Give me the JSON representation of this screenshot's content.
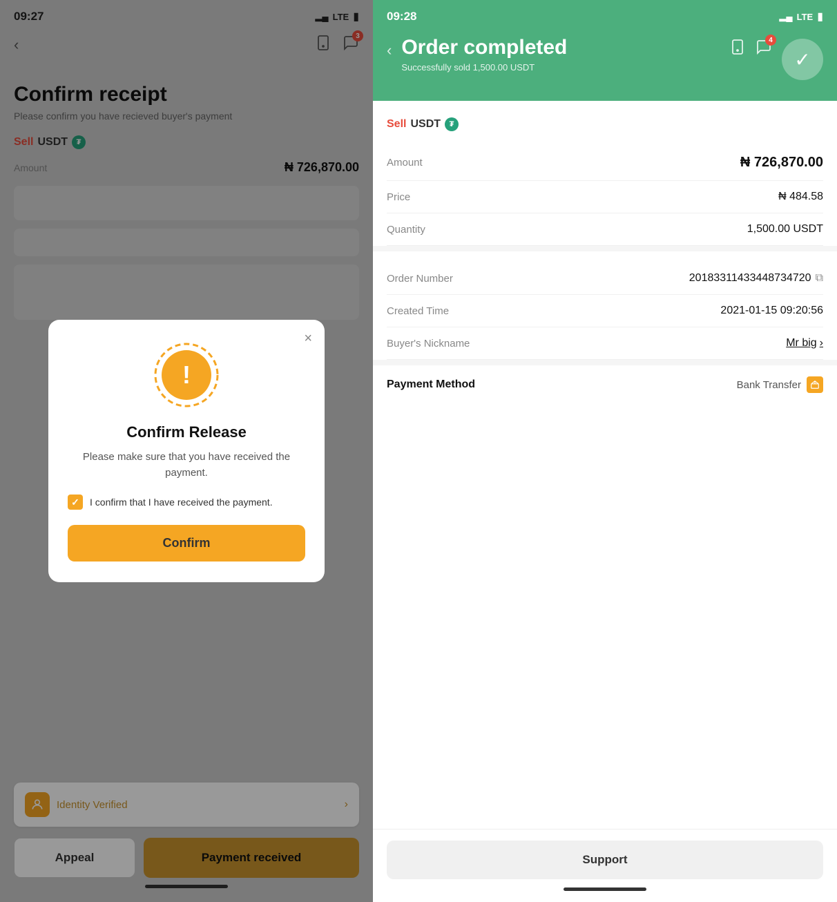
{
  "left": {
    "statusBar": {
      "time": "09:27",
      "signal": "▂▄",
      "lte": "LTE",
      "battery": "🔋"
    },
    "header": {
      "backArrow": "‹",
      "badge": "3"
    },
    "pageTitle": "Confirm receipt",
    "pageSubtitle": "Please confirm you have recieved buyer's payment",
    "sellLabel": "Sell",
    "usdtLabel": "USDT",
    "amountLabel": "Amount",
    "amountValue": "₦ 726,870.00",
    "identityLabel": "Identity Verified",
    "identityArrow": ">",
    "buttons": {
      "appeal": "Appeal",
      "paymentReceived": "Payment received"
    },
    "modal": {
      "title": "Confirm Release",
      "text": "Please make sure that you have received the payment.",
      "checkboxLabel": "I confirm that I have received the payment.",
      "confirmBtn": "Confirm",
      "closeBtn": "×"
    }
  },
  "right": {
    "statusBar": {
      "time": "09:28",
      "signal": "▂▄",
      "lte": "LTE",
      "battery": "🔋"
    },
    "header": {
      "backArrow": "‹",
      "title": "Order completed",
      "subtitle": "Successfully sold 1,500.00 USDT",
      "badge": "4"
    },
    "sellLabel": "Sell",
    "usdtLabel": "USDT",
    "rows": [
      {
        "label": "Amount",
        "value": "₦ 726,870.00",
        "large": true
      },
      {
        "label": "Price",
        "value": "₦ 484.58",
        "large": false
      },
      {
        "label": "Quantity",
        "value": "1,500.00 USDT",
        "large": false
      }
    ],
    "orderDetails": [
      {
        "label": "Order Number",
        "value": "2018331143344873 4720",
        "copy": true
      },
      {
        "label": "Created Time",
        "value": "2021-01-15 09:20:56"
      },
      {
        "label": "Buyer's Nickname",
        "value": "Mr big",
        "link": true
      }
    ],
    "paymentMethod": {
      "label": "Payment Method",
      "value": "Bank Transfer"
    },
    "supportBtn": "Support"
  }
}
